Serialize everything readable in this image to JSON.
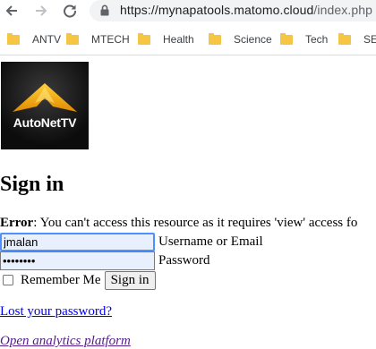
{
  "browser": {
    "url_main": "https://mynapatools.matomo.cloud",
    "url_path": "/index.php",
    "bookmarks": [
      "ANTV",
      "MTECH",
      "Health",
      "Science",
      "Tech",
      "SEC"
    ]
  },
  "logo": {
    "text": "AutoNetTV"
  },
  "page": {
    "title": "Sign in",
    "error_label": "Error",
    "error_message": ": You can't access this resource as it requires 'view' access fo",
    "username_value": "jmalan",
    "username_label": "Username or Email",
    "password_value": "jmalan12",
    "password_label": "Password",
    "remember_label": "Remember Me",
    "signin_button": "Sign in",
    "lost_password_link": "Lost your password?",
    "analytics_link": "Open analytics platform"
  },
  "colors": {
    "link": "#0000ee",
    "visited_link": "#551a8b",
    "autofill": "#e8f0fe",
    "focus": "#4d90fe",
    "logo_gold": "#f5a800"
  }
}
